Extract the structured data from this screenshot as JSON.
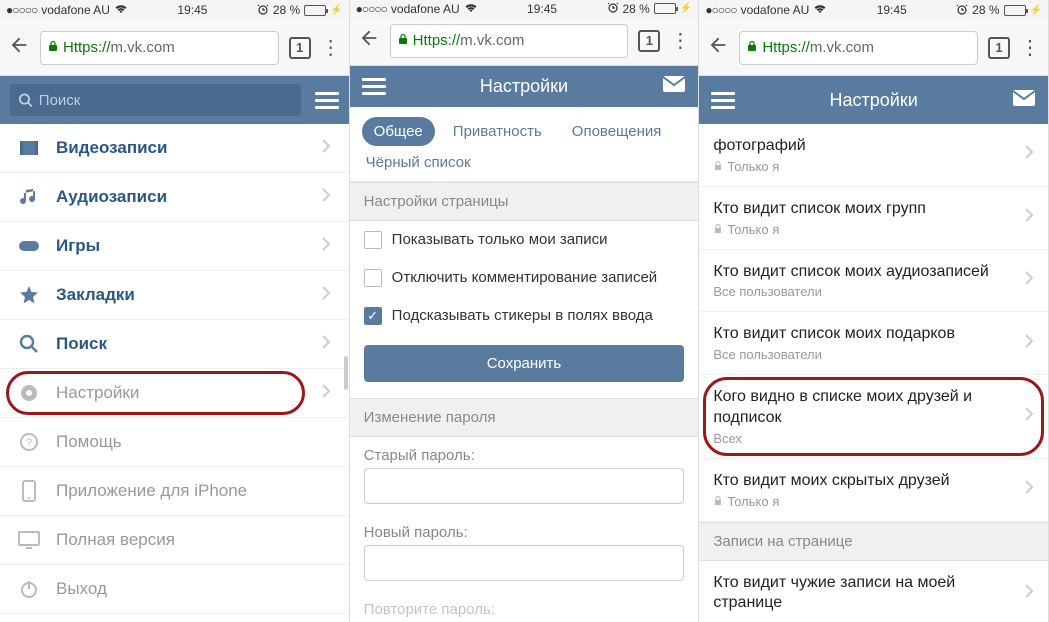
{
  "status": {
    "carrier": "vodafone AU",
    "time": "19:45",
    "battery_pct": "28 %"
  },
  "browser": {
    "url_https": "Https://",
    "url_rest": "m.vk.com",
    "tabs": "1"
  },
  "panel1": {
    "search_placeholder": "Поиск",
    "items": [
      {
        "label": "Видеозаписи"
      },
      {
        "label": "Аудиозаписи"
      },
      {
        "label": "Игры"
      },
      {
        "label": "Закладки"
      },
      {
        "label": "Поиск"
      },
      {
        "label": "Настройки"
      },
      {
        "label": "Помощь"
      },
      {
        "label": "Приложение для iPhone"
      },
      {
        "label": "Полная версия"
      },
      {
        "label": "Выход"
      }
    ]
  },
  "panel2": {
    "title": "Настройки",
    "tabs": {
      "general": "Общее",
      "privacy": "Приватность",
      "notif": "Оповещения"
    },
    "subtab": "Чёрный список",
    "section_page": "Настройки страницы",
    "checks": {
      "only_mine": "Показывать только мои записи",
      "disable_comments": "Отключить комментирование записей",
      "suggest_stickers": "Подсказывать стикеры в полях ввода"
    },
    "save": "Сохранить",
    "section_pw": "Изменение пароля",
    "old_pw": "Старый пароль:",
    "new_pw": "Новый пароль:",
    "repeat_pw": "Повторите пароль:"
  },
  "panel3": {
    "title": "Настройки",
    "only_me": "Только я",
    "all_users": "Все пользователи",
    "everyone": "Всех",
    "items": {
      "photos": "фотографий",
      "groups": "Кто видит список моих групп",
      "audio": "Кто видит список моих аудиозаписей",
      "gifts": "Кто видит список моих подарков",
      "friends": "Кого видно в списке моих друзей и подписок",
      "hidden": "Кто видит моих скрытых друзей"
    },
    "section_posts": "Записи на странице",
    "others_posts": "Кто видит чужие записи на моей странице"
  }
}
